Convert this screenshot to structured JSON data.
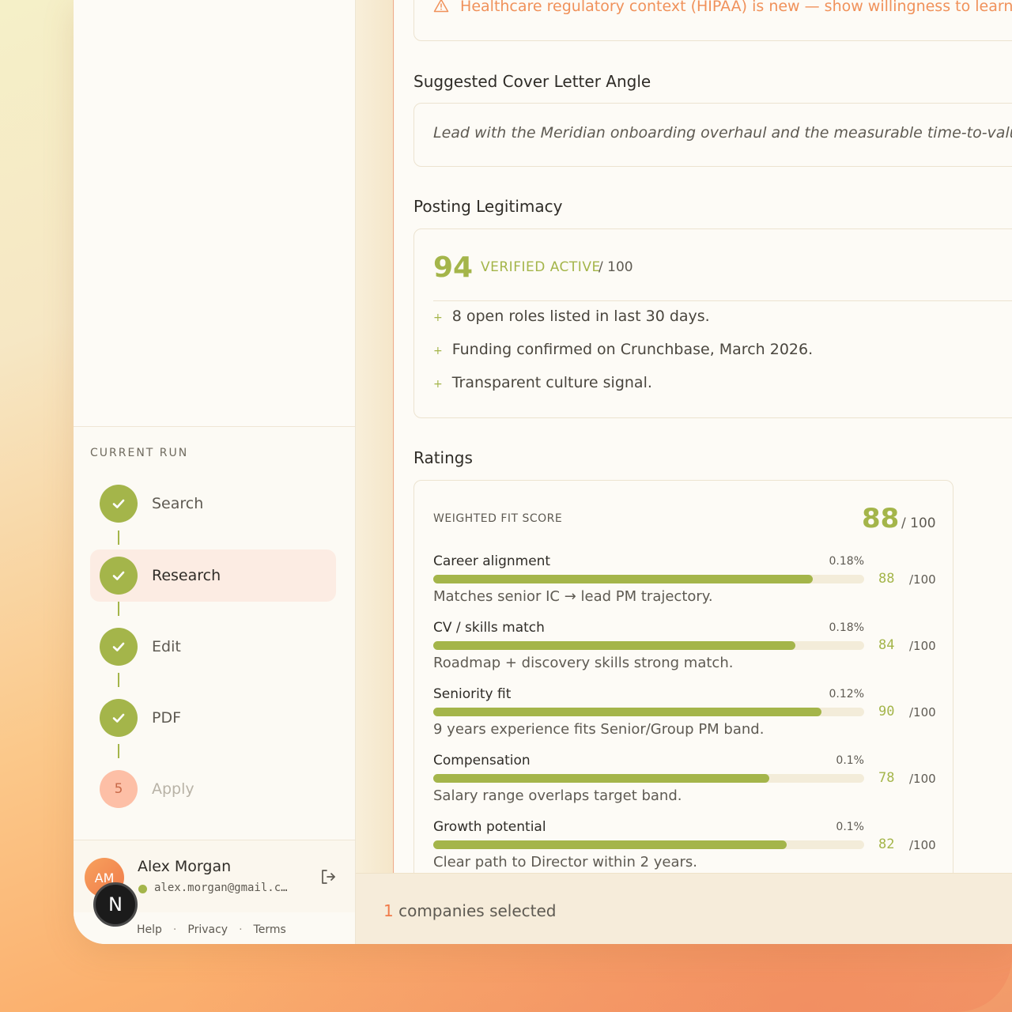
{
  "sidebar": {
    "run_heading": "CURRENT RUN",
    "steps": [
      {
        "label": "Search",
        "state": "done"
      },
      {
        "label": "Research",
        "state": "active"
      },
      {
        "label": "Edit",
        "state": "done"
      },
      {
        "label": "PDF",
        "state": "done"
      },
      {
        "label": "Apply",
        "state": "pending",
        "number": "5"
      }
    ],
    "user": {
      "initials": "AM",
      "name": "Alex Morgan",
      "email": "alex.morgan@gmail.c…"
    },
    "footer": {
      "help": "Help",
      "privacy": "Privacy",
      "terms": "Terms",
      "separator": "·"
    },
    "badge_letter": "N"
  },
  "main": {
    "warning": {
      "icon": "warning-triangle-icon",
      "text": "Healthcare regulatory context (HIPAA) is new — show willingness to learn"
    },
    "cover_letter": {
      "title": "Suggested Cover Letter Angle",
      "text": "Lead with the Meridian onboarding overhaul and the measurable time-to-value imp"
    },
    "legitimacy": {
      "title": "Posting Legitimacy",
      "score": "94",
      "status": "VERIFIED ACTIVE",
      "denominator": "/ 100",
      "items": [
        "8 open roles listed in last 30 days.",
        "Funding confirmed on Crunchbase, March 2026.",
        "Transparent culture signal."
      ]
    },
    "ratings": {
      "title": "Ratings",
      "heading": "WEIGHTED FIT SCORE",
      "total": "88",
      "total_denom": "/ 100",
      "criteria": [
        {
          "name": "Career alignment",
          "weight": "0.18%",
          "score": 88,
          "of": "/100",
          "note": "Matches senior IC → lead PM trajectory."
        },
        {
          "name": "CV / skills match",
          "weight": "0.18%",
          "score": 84,
          "of": "/100",
          "note": "Roadmap + discovery skills strong match."
        },
        {
          "name": "Seniority fit",
          "weight": "0.12%",
          "score": 90,
          "of": "/100",
          "note": "9 years experience fits Senior/Group PM band."
        },
        {
          "name": "Compensation",
          "weight": "0.1%",
          "score": 78,
          "of": "/100",
          "note": "Salary range overlaps target band."
        },
        {
          "name": "Growth potential",
          "weight": "0.1%",
          "score": 82,
          "of": "/100",
          "note": "Clear path to Director within 2 years."
        }
      ]
    }
  },
  "bottom_bar": {
    "count": "1",
    "label": "companies selected"
  },
  "colors": {
    "accent_green": "#a4b54a",
    "accent_orange": "#f07b4a",
    "warning": "#f0915a"
  }
}
